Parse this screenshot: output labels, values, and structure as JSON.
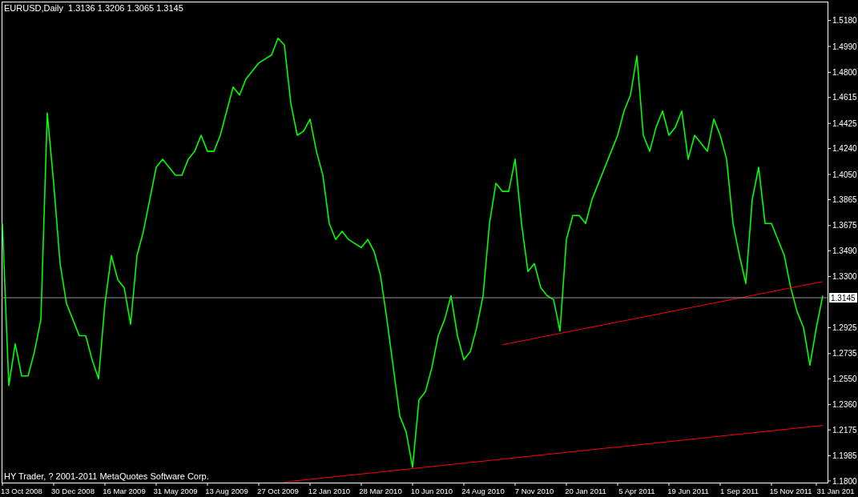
{
  "chart": {
    "chart_data": {
      "type": "line",
      "title": "EURUSD,Daily  1.3136 1.3206 1.3065 1.3145",
      "categories": [
        null,
        null,
        null,
        "13 Oct 2008",
        null,
        null,
        null,
        null,
        null,
        null,
        null,
        "30 Dec 2008",
        null,
        null,
        null,
        null,
        null,
        null,
        null,
        "16 Mar 2009",
        null,
        null,
        null,
        null,
        null,
        null,
        null,
        "31 May 2009",
        null,
        null,
        null,
        null,
        null,
        null,
        null,
        "13 Aug 2009",
        null,
        null,
        null,
        null,
        null,
        null,
        null,
        "27 Oct 2009",
        null,
        null,
        null,
        null,
        null,
        null,
        null,
        "12 Jan 2010",
        null,
        null,
        null,
        null,
        null,
        null,
        null,
        "28 Mar 2010",
        null,
        null,
        null,
        null,
        null,
        null,
        null,
        "10 Jun 2010",
        null,
        null,
        null,
        null,
        null,
        null,
        null,
        "24 Aug 2010",
        null,
        null,
        null,
        null,
        null,
        null,
        null,
        "7 Nov 2010",
        null,
        null,
        null,
        null,
        null,
        null,
        null,
        "20 Jan 2011",
        null,
        null,
        null,
        null,
        null,
        null,
        null,
        "5 Apr 2011",
        null,
        null,
        null,
        null,
        null,
        null,
        null,
        "19 Jun 2011",
        null,
        null,
        null,
        null,
        null,
        null,
        null,
        "1 Sep 2011",
        null,
        null,
        null,
        null,
        null,
        null,
        null,
        "15 Nov 2011",
        null,
        null,
        null,
        null,
        null,
        null,
        "31 Jan 201"
      ],
      "ylim": [
        1.1788,
        1.5319
      ],
      "yticks": [
        {
          "value": 1.518,
          "label": "1.5180"
        },
        {
          "value": 1.499,
          "label": "1.4990"
        },
        {
          "value": 1.48,
          "label": "1.4800"
        },
        {
          "value": 1.4615,
          "label": "1.4615"
        },
        {
          "value": 1.4425,
          "label": "1.4425"
        },
        {
          "value": 1.424,
          "label": "1.4240"
        },
        {
          "value": 1.405,
          "label": "1.4050"
        },
        {
          "value": 1.3865,
          "label": "1.3865"
        },
        {
          "value": 1.3675,
          "label": "1.3675"
        },
        {
          "value": 1.349,
          "label": "1.3490"
        },
        {
          "value": 1.33,
          "label": "1.3300"
        },
        {
          "value": 1.2925,
          "label": "1.2925"
        },
        {
          "value": 1.2735,
          "label": "1.2735"
        },
        {
          "value": 1.255,
          "label": "1.2550"
        },
        {
          "value": 1.236,
          "label": "1.2360"
        },
        {
          "value": 1.2175,
          "label": "1.2175"
        },
        {
          "value": 1.1985,
          "label": "1.1985"
        },
        {
          "value": 1.18,
          "label": "1.1800"
        }
      ],
      "series": [
        {
          "color": "#00ff00",
          "values": [
            1.369,
            1.25,
            1.2807,
            1.2571,
            1.2571,
            1.2748,
            1.2984,
            1.45,
            1.3985,
            1.3396,
            1.3102,
            1.2984,
            1.2866,
            1.2866,
            1.2689,
            1.255,
            1.3102,
            1.3455,
            1.3278,
            1.3219,
            1.295,
            1.3455,
            1.3632,
            1.3867,
            1.4103,
            1.4162,
            1.4103,
            1.4044,
            1.4044,
            1.4162,
            1.422,
            1.4338,
            1.422,
            1.422,
            1.4338,
            1.4515,
            1.4692,
            1.4633,
            1.4751,
            1.4809,
            1.4868,
            1.4898,
            1.4927,
            1.505,
            1.5,
            1.4574,
            1.4338,
            1.4368,
            1.4456,
            1.422,
            1.4044,
            1.369,
            1.3573,
            1.3632,
            1.3573,
            1.3543,
            1.3514,
            1.3573,
            1.3484,
            1.3308,
            1.2984,
            1.263,
            1.2277,
            1.2159,
            1.19,
            1.2395,
            1.2454,
            1.263,
            1.2866,
            1.2984,
            1.316,
            1.2866,
            1.2689,
            1.2748,
            1.2925,
            1.316,
            1.369,
            1.3985,
            1.3926,
            1.3926,
            1.4162,
            1.369,
            1.3337,
            1.3396,
            1.3219,
            1.316,
            1.3131,
            1.29,
            1.3573,
            1.3749,
            1.3749,
            1.369,
            1.3867,
            1.3985,
            1.4103,
            1.422,
            1.4338,
            1.4515,
            1.4633,
            1.492,
            1.4338,
            1.422,
            1.4397,
            1.4515,
            1.4338,
            1.4397,
            1.4515,
            1.4162,
            1.4338,
            1.4279,
            1.422,
            1.4456,
            1.4338,
            1.4162,
            1.369,
            1.3455,
            1.325,
            1.3867,
            1.4103,
            1.369,
            1.369,
            1.3573,
            1.3455,
            1.3219,
            1.3043,
            1.2925,
            1.265,
            1.2925,
            1.316,
            null,
            null
          ]
        },
        {
          "color": "#ff0000",
          "values": [
            null,
            null,
            null,
            null,
            null,
            null,
            null,
            null,
            null,
            null,
            null,
            null,
            null,
            null,
            null,
            null,
            null,
            null,
            null,
            null,
            null,
            null,
            null,
            null,
            null,
            null,
            null,
            null,
            null,
            null,
            null,
            null,
            null,
            null,
            null,
            null,
            null,
            null,
            null,
            null,
            null,
            null,
            null,
            null,
            null,
            null,
            null,
            null,
            null,
            null,
            null,
            null,
            null,
            null,
            null,
            null,
            null,
            null,
            null,
            null,
            null,
            null,
            null,
            null,
            null,
            null,
            null,
            null,
            null,
            null,
            null,
            null,
            null,
            null,
            null,
            null,
            null,
            null,
            1.28,
            1.2809,
            1.2819,
            1.2828,
            1.2837,
            1.2846,
            1.2856,
            1.2865,
            1.2874,
            1.2883,
            1.2893,
            1.2902,
            1.2911,
            1.2921,
            1.293,
            1.2939,
            1.2948,
            1.2958,
            1.2967,
            1.2976,
            1.2985,
            1.2995,
            1.3004,
            1.3013,
            1.3022,
            1.3032,
            1.3041,
            1.305,
            1.306,
            1.3069,
            1.3078,
            1.3087,
            1.3097,
            1.3106,
            1.3115,
            1.3124,
            1.3134,
            1.3143,
            1.3152,
            1.3162,
            1.3171,
            1.318,
            1.3189,
            1.3199,
            1.3208,
            1.3217,
            1.3226,
            1.3236,
            1.3245,
            1.3254,
            1.3263,
            null,
            null
          ]
        },
        {
          "color": "#ff0000",
          "values": [
            null,
            null,
            null,
            null,
            null,
            null,
            null,
            null,
            null,
            null,
            null,
            null,
            null,
            null,
            null,
            null,
            null,
            null,
            null,
            null,
            null,
            null,
            null,
            null,
            null,
            null,
            null,
            null,
            null,
            null,
            null,
            null,
            null,
            null,
            null,
            null,
            null,
            null,
            null,
            null,
            null,
            null,
            null,
            null,
            1.1792,
            1.1797,
            1.1802,
            1.1807,
            1.1812,
            1.1817,
            1.1822,
            1.1827,
            1.1832,
            1.1837,
            1.1842,
            1.1846,
            1.1851,
            1.1856,
            1.1861,
            1.1866,
            1.1871,
            1.1876,
            1.1881,
            1.1886,
            1.1891,
            1.1896,
            1.1901,
            1.1906,
            1.1911,
            1.1916,
            1.1921,
            1.1926,
            1.1931,
            1.1936,
            1.1941,
            1.1945,
            1.195,
            1.1955,
            1.196,
            1.1965,
            1.197,
            1.1975,
            1.198,
            1.1985,
            1.199,
            1.1995,
            1.2,
            1.2005,
            1.201,
            1.2015,
            1.202,
            1.2025,
            1.203,
            1.2035,
            1.204,
            1.2044,
            1.2049,
            1.2054,
            1.2059,
            1.2064,
            1.2069,
            1.2074,
            1.2079,
            1.2084,
            1.2089,
            1.2094,
            1.2099,
            1.2104,
            1.2109,
            1.2114,
            1.2119,
            1.2124,
            1.2129,
            1.2134,
            1.2139,
            1.2143,
            1.2148,
            1.2153,
            1.2158,
            1.2163,
            1.2168,
            1.2173,
            1.2178,
            1.2183,
            1.2188,
            1.2193,
            1.2198,
            1.2203,
            1.2208,
            null,
            null
          ]
        }
      ],
      "ref_lines": [
        {
          "axis": "y",
          "value": 1.3145,
          "label": "1.3145"
        }
      ]
    },
    "copyright": "HY Trader, ? 2001-2011 MetaQuotes Software Corp."
  }
}
